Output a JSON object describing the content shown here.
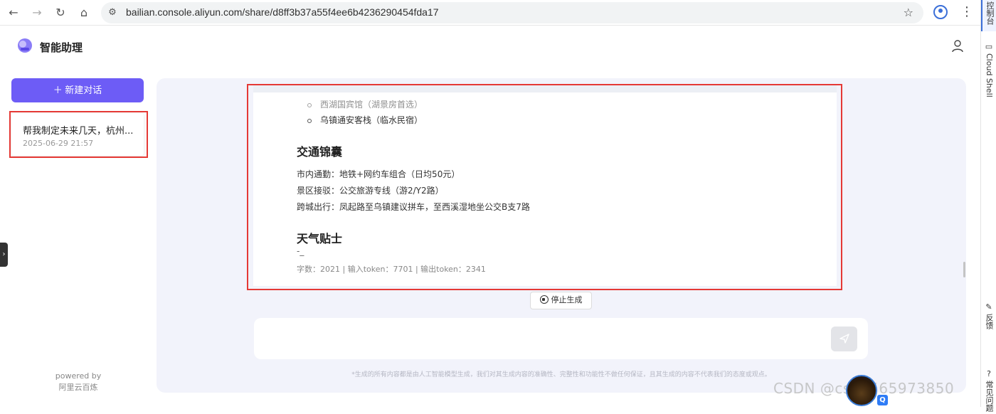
{
  "browser": {
    "url": "bailian.console.aliyun.com/share/d8ff3b37a55f4ee6b4236290454fda17"
  },
  "right_rail": {
    "console_label": "控制台",
    "cloud_shell_label": "Cloud Shell",
    "feedback_label": "反馈",
    "faq_label": "常见问题"
  },
  "app": {
    "title": "智能助理"
  },
  "sidebar": {
    "new_chat_label": "＋ 新建对话",
    "chats": [
      {
        "title": "帮我制定未来几天，杭州...",
        "date": "2025-06-29 21:57"
      }
    ],
    "powered_by": "powered by",
    "powered_name": "阿里云百炼"
  },
  "content": {
    "cut_bullet": "西湖国宾馆（湖景房首选）",
    "bullet_2": "乌镇通安客栈（临水民宿）",
    "section_transport": "交通锦囊",
    "transport_lines": [
      "市内通勤：地铁+网约车组合（日均50元）",
      "景区接驳：公交旅游专线（游2/Y2路）",
      "跨城出行：凤起路至乌镇建议拼车，至西溪湿地坐公交B支7路"
    ],
    "section_weather": "天气贴士",
    "cursor": "-_",
    "stats": "字数：2021  |   输入token：7701 |   输出token：2341"
  },
  "stop_button_label": "停止生成",
  "input": {
    "placeholder": ""
  },
  "disclaimer": "*生成的所有内容都是由人工智能模型生成，我们对其生成内容的准确性、完整性和功能性不做任何保证，且其生成的内容不代表我们的态度或观点。",
  "watermark": "CSDN @csdn565973850",
  "colors": {
    "accent": "#6d5cf6",
    "highlight_red": "#e53935",
    "main_bg": "#f2f3fb"
  }
}
